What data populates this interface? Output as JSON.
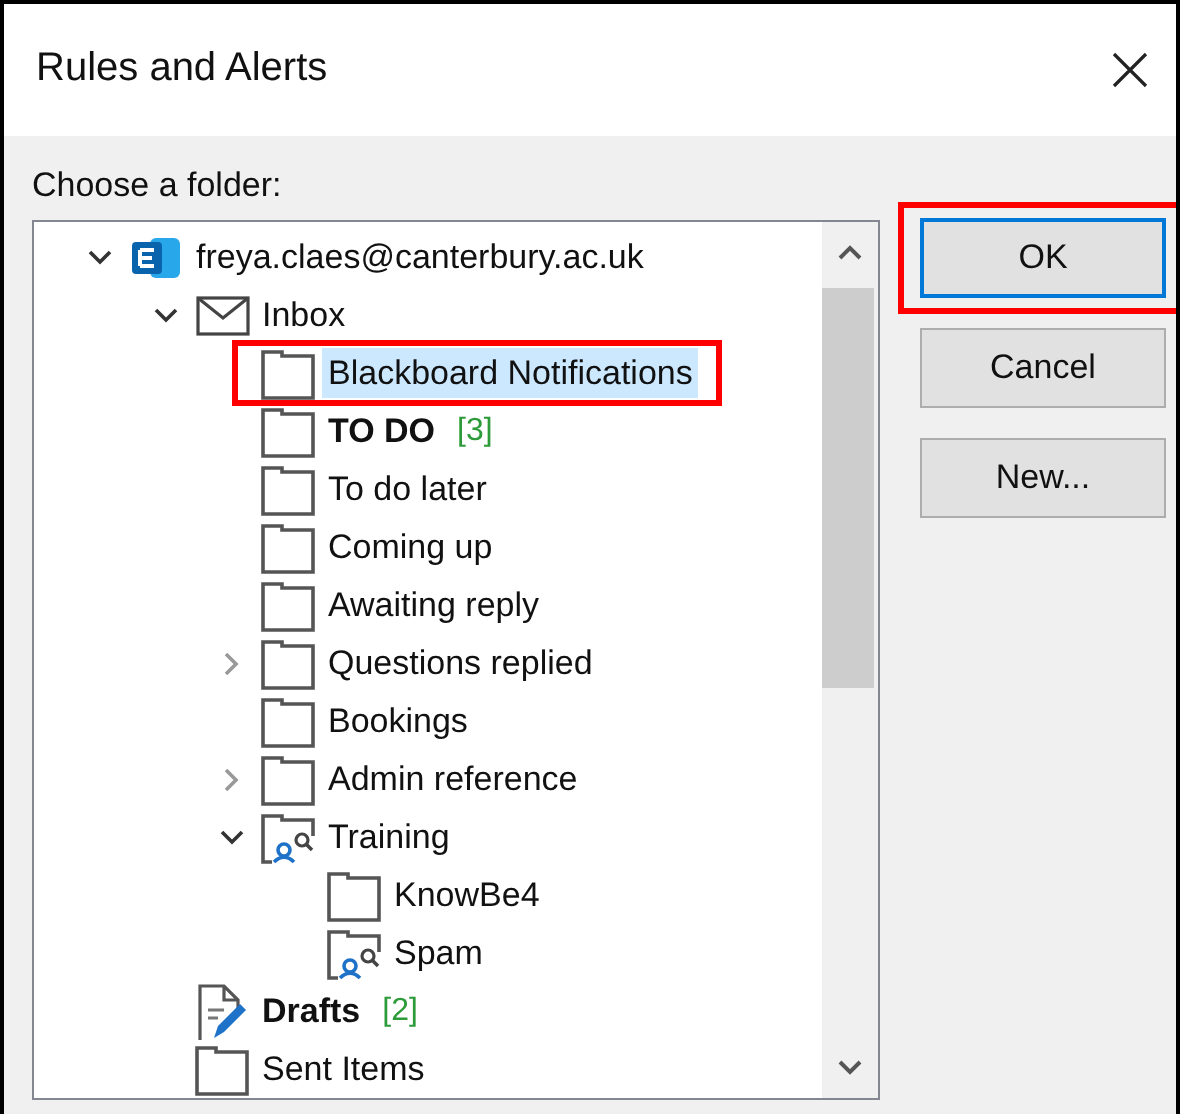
{
  "window": {
    "title": "Rules and Alerts"
  },
  "prompt": "Choose a folder:",
  "tree": [
    {
      "label": "freya.claes@canterbury.ac.uk",
      "kind": "account",
      "expanded": true,
      "children": [
        {
          "label": "Inbox",
          "kind": "mail",
          "expanded": true,
          "children": [
            {
              "label": "Blackboard Notifications",
              "kind": "folder",
              "selected": true,
              "annotated": true
            },
            {
              "label": "TO DO",
              "kind": "folder",
              "bold": true,
              "count": "[3]",
              "selected": false
            },
            {
              "label": "To do later",
              "kind": "folder",
              "selected": false
            },
            {
              "label": "Coming up",
              "kind": "folder",
              "selected": false
            },
            {
              "label": "Awaiting reply",
              "kind": "folder",
              "selected": false
            },
            {
              "label": "Questions replied",
              "kind": "folder",
              "expanded": false,
              "selected": false
            },
            {
              "label": "Bookings",
              "kind": "folder",
              "selected": false
            },
            {
              "label": "Admin reference",
              "kind": "folder",
              "expanded": false,
              "selected": false
            },
            {
              "label": "Training",
              "kind": "search-folder",
              "expanded": true,
              "selected": false,
              "children": [
                {
                  "label": "KnowBe4",
                  "kind": "folder",
                  "selected": false
                },
                {
                  "label": "Spam",
                  "kind": "search-folder",
                  "selected": false
                }
              ]
            }
          ]
        },
        {
          "label": "Drafts",
          "kind": "drafts",
          "bold": true,
          "count": "[2]",
          "selected": false
        },
        {
          "label": "Sent Items",
          "kind": "folder",
          "selected": false
        }
      ]
    }
  ],
  "buttons": [
    {
      "label": "OK",
      "default": true,
      "annotated": true
    },
    {
      "label": "Cancel",
      "default": false
    },
    {
      "label": "New...",
      "default": false
    }
  ]
}
